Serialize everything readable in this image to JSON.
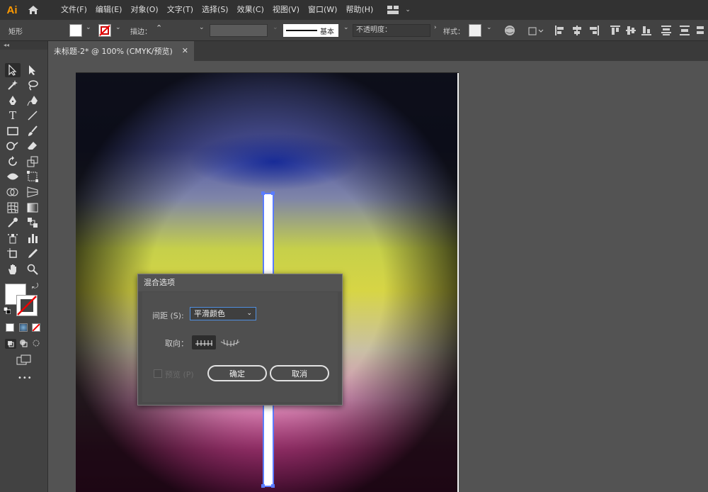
{
  "app": {
    "logo_text": "Ai"
  },
  "menu": [
    "文件(F)",
    "编辑(E)",
    "对象(O)",
    "文字(T)",
    "选择(S)",
    "效果(C)",
    "视图(V)",
    "窗口(W)",
    "帮助(H)"
  ],
  "control_bar": {
    "object_type": "矩形",
    "stroke_label": "描边：",
    "stroke_style": "基本",
    "opacity_label": "不透明度：",
    "style_label": "样式："
  },
  "document_tab": {
    "title": "未标题-2* @ 100% (CMYK/预览)",
    "close": "✕"
  },
  "toolbox": {
    "header": "◂◂",
    "more": "•••"
  },
  "dialog": {
    "title": "混合选项",
    "spacing_label": "间距 (S):",
    "spacing_value": "平滑颜色",
    "orientation_label": "取向：",
    "preview_label": "预览 (P)",
    "ok_label": "确定",
    "cancel_label": "取消"
  },
  "colors": {
    "accent": "#5a7cff",
    "logo": "#ff9a00",
    "menubar_bg": "#323232",
    "panel_bg": "#424242",
    "pasteboard": "#535353"
  },
  "icons": [
    "home-icon",
    "workspace-icon",
    "selection-tool-icon",
    "direct-selection-icon",
    "magic-wand-icon",
    "lasso-icon",
    "pen-icon",
    "curvature-icon",
    "type-icon",
    "line-icon",
    "rectangle-icon",
    "paintbrush-icon",
    "shaper-icon",
    "eraser-icon",
    "rotate-icon",
    "scale-icon",
    "width-icon",
    "free-transform-icon",
    "shape-builder-icon",
    "perspective-grid-icon",
    "mesh-icon",
    "gradient-icon",
    "eyedropper-icon",
    "blend-icon",
    "symbol-sprayer-icon",
    "column-graph-icon",
    "artboard-icon",
    "slice-icon",
    "hand-icon",
    "zoom-icon",
    "globe-icon",
    "align-icon"
  ]
}
